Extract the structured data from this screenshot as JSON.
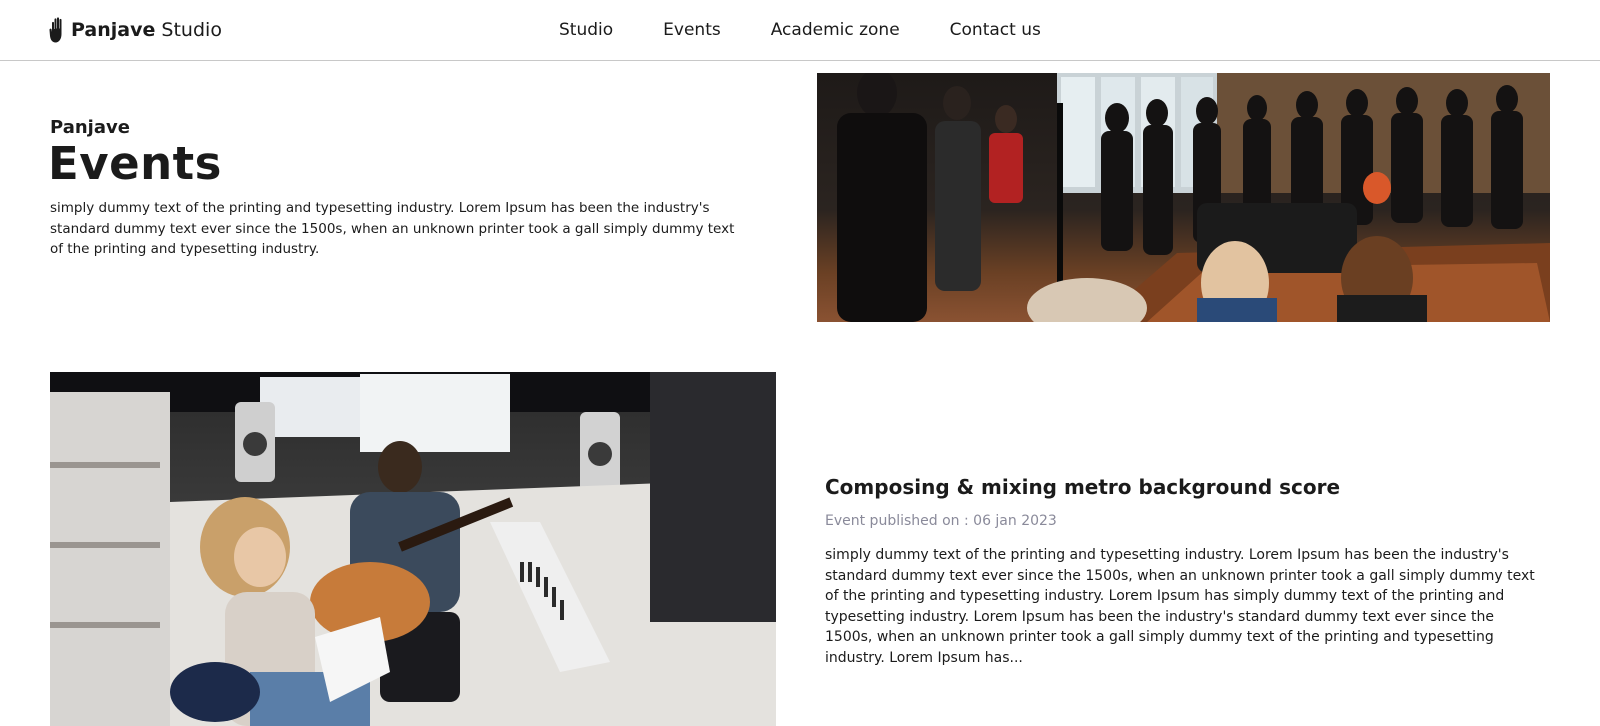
{
  "header": {
    "logo": {
      "brand": "Panjave",
      "suffix": "Studio",
      "icon": "hand-icon"
    },
    "nav": [
      {
        "label": "Studio"
      },
      {
        "label": "Events"
      },
      {
        "label": "Academic zone"
      },
      {
        "label": "Contact us"
      }
    ]
  },
  "hero": {
    "subtitle": "Panjave",
    "title": "Events",
    "description": "simply dummy text of the printing and typesetting industry. Lorem Ipsum has been the industry's standard dummy text ever since the 1500s, when an unknown printer took a gall simply dummy text of the printing and typesetting industry."
  },
  "event": {
    "title": "Composing & mixing metro background score",
    "published": "Event published on : 06 jan 2023",
    "description": "simply dummy text of the printing and typesetting industry. Lorem Ipsum has been the industry's standard dummy text ever since the 1500s, when an unknown printer took a gall simply dummy text of the printing and typesetting industry. Lorem Ipsum has simply dummy text of the printing and typesetting industry. Lorem Ipsum has been the industry's standard dummy text ever since the 1500s, when an unknown printer took a gall simply dummy text of the printing and typesetting industry. Lorem Ipsum has..."
  }
}
